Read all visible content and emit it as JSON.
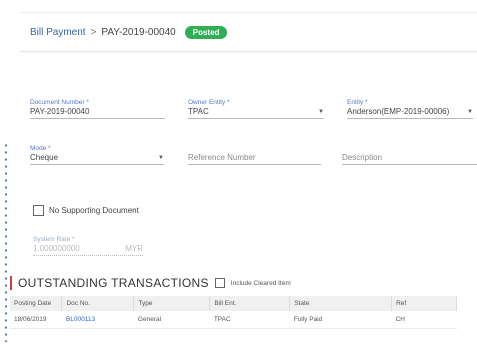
{
  "breadcrumb": {
    "parent": "Bill Payment",
    "separator": ">",
    "current": "PAY-2019-00040"
  },
  "status": {
    "label": "Posted",
    "color": "#2fae55"
  },
  "form": {
    "document_number": {
      "label": "Document Number *",
      "value": "PAY-2019-00040"
    },
    "owner_entity": {
      "label": "Owner Entity *",
      "value": "TPAC"
    },
    "entity": {
      "label": "Entity *",
      "value": "Anderson(EMP-2019-00006)"
    },
    "mode": {
      "label": "Mode *",
      "value": "Cheque"
    },
    "reference_number": {
      "placeholder": "Reference Number"
    },
    "description": {
      "placeholder": "Description"
    },
    "no_supporting_document": {
      "label": "No Supporting Document",
      "checked": false
    },
    "system_rate": {
      "label": "System Rate *",
      "value": "1.000000000",
      "unit": "MYR"
    }
  },
  "transactions": {
    "title": "OUTSTANDING TRANSACTIONS",
    "include_cleared_label": "Include Cleared Item",
    "columns": [
      "Posting Date",
      "Doc No.",
      "Type",
      "Bill Ent.",
      "State",
      "Ref"
    ],
    "rows": [
      [
        "18/06/2019",
        "BL000113",
        "General",
        "TPAC",
        "Fully Paid",
        "CH"
      ]
    ]
  },
  "colors": {
    "accent": "#3366aa",
    "section_marker": "#d04040",
    "label": "#5577cc"
  }
}
